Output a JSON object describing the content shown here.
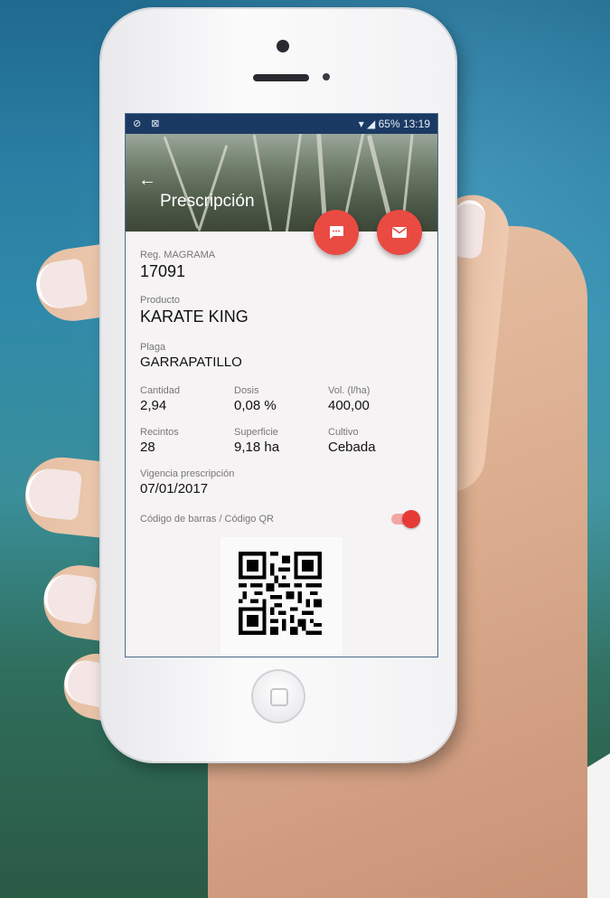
{
  "statusbar": {
    "left_icons": "⊘ ⊠",
    "right_text": "65% 13:19"
  },
  "header": {
    "back_icon": "arrow-left-icon",
    "title": "Prescripción",
    "actions": [
      {
        "name": "chat-button",
        "icon": "message-icon"
      },
      {
        "name": "email-button",
        "icon": "mail-icon"
      }
    ],
    "accent_color": "#e94b43",
    "statusbar_color": "#1b3a63"
  },
  "details": {
    "reg_label": "Reg. MAGRAMA",
    "reg_value": "17091",
    "producto_label": "Producto",
    "producto_value": "KARATE KING",
    "plaga_label": "Plaga",
    "plaga_value": "GARRAPATILLO",
    "cantidad_label": "Cantidad",
    "cantidad_value": "2,94",
    "dosis_label": "Dosis",
    "dosis_value": "0,08 %",
    "vol_label": "Vol. (l/ha)",
    "vol_value": "400,00",
    "recintos_label": "Recintos",
    "recintos_value": "28",
    "superficie_label": "Superficie",
    "superficie_value": "9,18 ha",
    "cultivo_label": "Cultivo",
    "cultivo_value": "Cebada",
    "vigencia_label": "Vigencia prescripción",
    "vigencia_value": "07/01/2017"
  },
  "barcode": {
    "toggle_label": "Código de barras / Código QR",
    "toggle_on": true
  }
}
